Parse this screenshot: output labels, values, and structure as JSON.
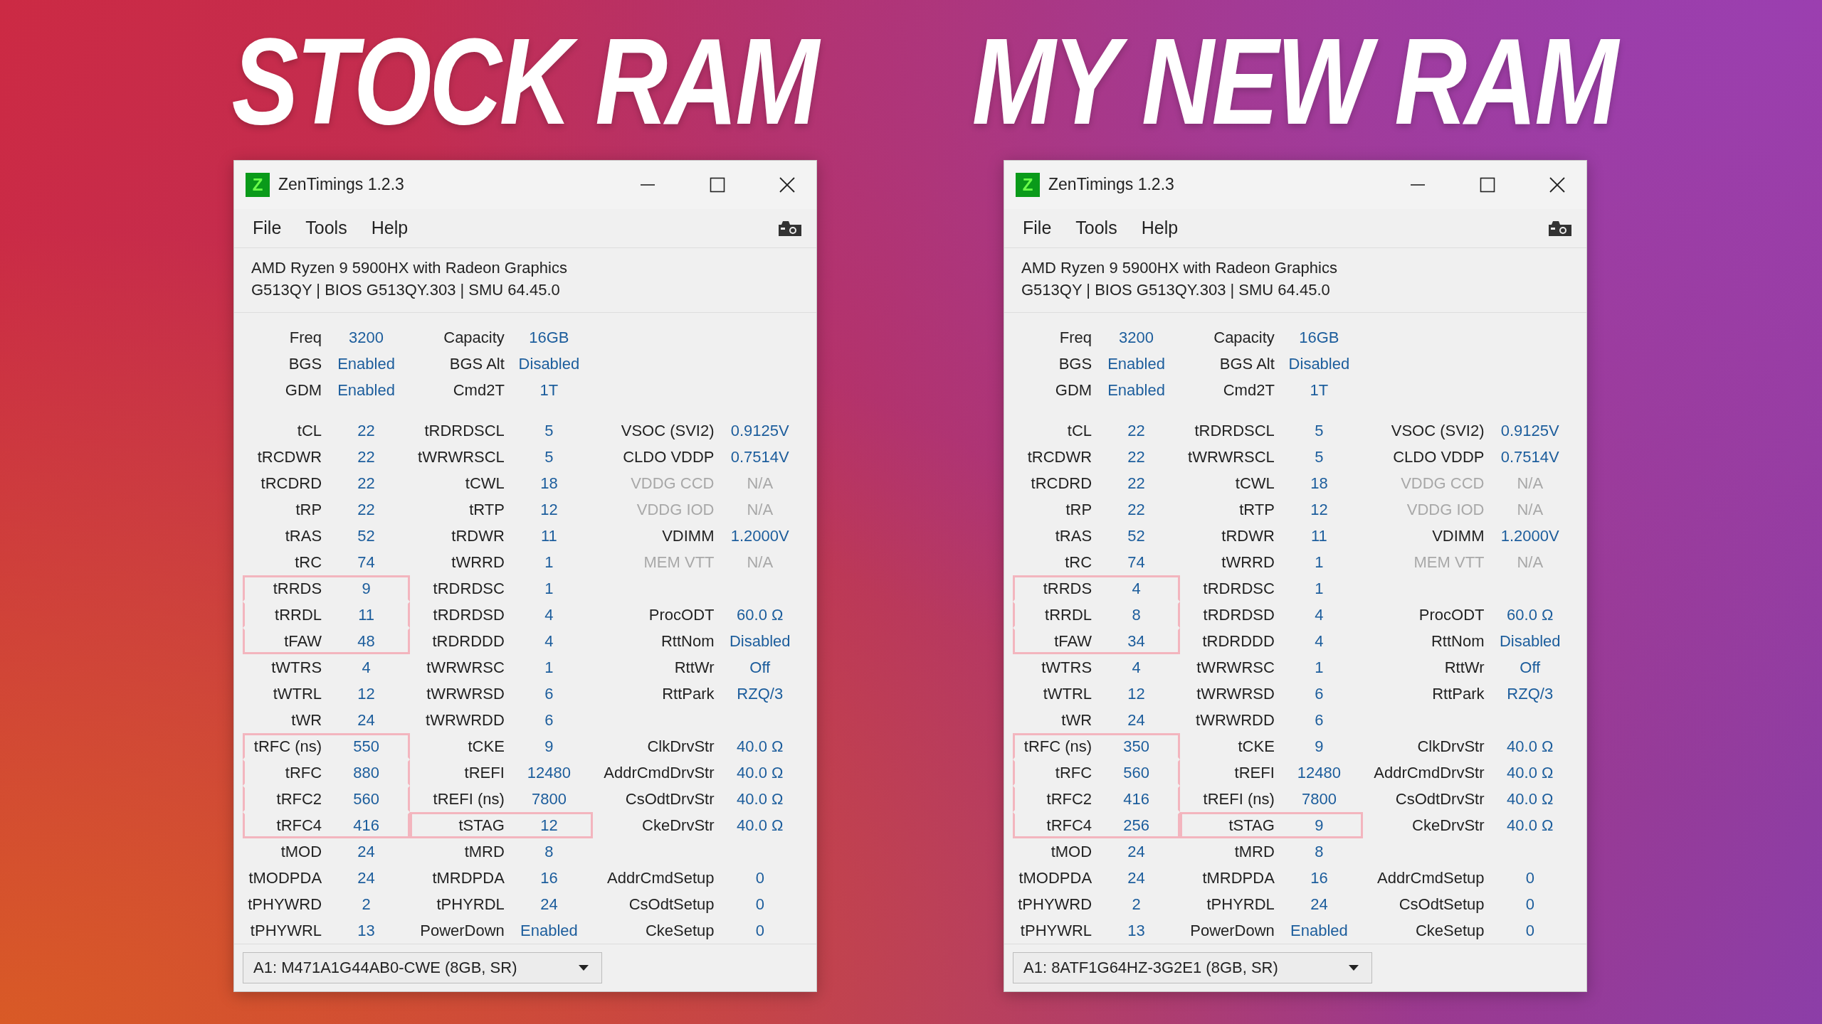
{
  "headlines": [
    "STOCK RAM",
    "MY NEW RAM"
  ],
  "windows": [
    {
      "title": "ZenTimings 1.2.3",
      "icon_letter": "Z",
      "menu": [
        "File",
        "Tools",
        "Help"
      ],
      "cpu": "AMD Ryzen 9 5900HX with Radeon Graphics",
      "bios": "G513QY | BIOS G513QY.303 | SMU 64.45.0",
      "summary": [
        [
          {
            "label": "Freq",
            "value": "3200"
          },
          {
            "label": "Capacity",
            "value": "16GB"
          }
        ],
        [
          {
            "label": "BGS",
            "value": "Enabled"
          },
          {
            "label": "BGS Alt",
            "value": "Disabled"
          }
        ],
        [
          {
            "label": "GDM",
            "value": "Enabled"
          },
          {
            "label": "Cmd2T",
            "value": "1T"
          }
        ]
      ],
      "rows": [
        [
          {
            "label": "tCL",
            "value": "22",
            "highlighted": false,
            "disabled": false
          },
          {
            "label": "tRDRDSCL",
            "value": "5",
            "highlighted": false,
            "disabled": false
          },
          {
            "label": "VSOC (SVI2)",
            "value": "0.9125V",
            "highlighted": false,
            "disabled": false
          }
        ],
        [
          {
            "label": "tRCDWR",
            "value": "22",
            "highlighted": false,
            "disabled": false
          },
          {
            "label": "tWRWRSCL",
            "value": "5",
            "highlighted": false,
            "disabled": false
          },
          {
            "label": "CLDO VDDP",
            "value": "0.7514V",
            "highlighted": false,
            "disabled": false
          }
        ],
        [
          {
            "label": "tRCDRD",
            "value": "22",
            "highlighted": false,
            "disabled": false
          },
          {
            "label": "tCWL",
            "value": "18",
            "highlighted": false,
            "disabled": false
          },
          {
            "label": "VDDG CCD",
            "value": "N/A",
            "highlighted": false,
            "disabled": true
          }
        ],
        [
          {
            "label": "tRP",
            "value": "22",
            "highlighted": false,
            "disabled": false
          },
          {
            "label": "tRTP",
            "value": "12",
            "highlighted": false,
            "disabled": false
          },
          {
            "label": "VDDG IOD",
            "value": "N/A",
            "highlighted": false,
            "disabled": true
          }
        ],
        [
          {
            "label": "tRAS",
            "value": "52",
            "highlighted": false,
            "disabled": false
          },
          {
            "label": "tRDWR",
            "value": "11",
            "highlighted": false,
            "disabled": false
          },
          {
            "label": "VDIMM",
            "value": "1.2000V",
            "highlighted": false,
            "disabled": false
          }
        ],
        [
          {
            "label": "tRC",
            "value": "74",
            "highlighted": false,
            "disabled": false
          },
          {
            "label": "tWRRD",
            "value": "1",
            "highlighted": false,
            "disabled": false
          },
          {
            "label": "MEM VTT",
            "value": "N/A",
            "highlighted": false,
            "disabled": true
          }
        ],
        [
          {
            "label": "tRRDS",
            "value": "9",
            "highlighted": true,
            "disabled": false
          },
          {
            "label": "tRDRDSC",
            "value": "1",
            "highlighted": false,
            "disabled": false
          }
        ],
        [
          {
            "label": "tRRDL",
            "value": "11",
            "highlighted": true,
            "disabled": false
          },
          {
            "label": "tRDRDSD",
            "value": "4",
            "highlighted": false,
            "disabled": false
          },
          {
            "label": "ProcODT",
            "value": "60.0 Ω",
            "highlighted": false,
            "disabled": false
          }
        ],
        [
          {
            "label": "tFAW",
            "value": "48",
            "highlighted": true,
            "disabled": false
          },
          {
            "label": "tRDRDDD",
            "value": "4",
            "highlighted": false,
            "disabled": false
          },
          {
            "label": "RttNom",
            "value": "Disabled",
            "highlighted": false,
            "disabled": false
          }
        ],
        [
          {
            "label": "tWTRS",
            "value": "4",
            "highlighted": false,
            "disabled": false
          },
          {
            "label": "tWRWRSC",
            "value": "1",
            "highlighted": false,
            "disabled": false
          },
          {
            "label": "RttWr",
            "value": "Off",
            "highlighted": false,
            "disabled": false
          }
        ],
        [
          {
            "label": "tWTRL",
            "value": "12",
            "highlighted": false,
            "disabled": false
          },
          {
            "label": "tWRWRSD",
            "value": "6",
            "highlighted": false,
            "disabled": false
          },
          {
            "label": "RttPark",
            "value": "RZQ/3",
            "highlighted": false,
            "disabled": false
          }
        ],
        [
          {
            "label": "tWR",
            "value": "24",
            "highlighted": false,
            "disabled": false
          },
          {
            "label": "tWRWRDD",
            "value": "6",
            "highlighted": false,
            "disabled": false
          }
        ],
        [
          {
            "label": "tRFC (ns)",
            "value": "550",
            "highlighted": true,
            "disabled": false
          },
          {
            "label": "tCKE",
            "value": "9",
            "highlighted": false,
            "disabled": false
          },
          {
            "label": "ClkDrvStr",
            "value": "40.0 Ω",
            "highlighted": false,
            "disabled": false
          }
        ],
        [
          {
            "label": "tRFC",
            "value": "880",
            "highlighted": true,
            "disabled": false
          },
          {
            "label": "tREFI",
            "value": "12480",
            "highlighted": false,
            "disabled": false
          },
          {
            "label": "AddrCmdDrvStr",
            "value": "40.0 Ω",
            "highlighted": false,
            "disabled": false
          }
        ],
        [
          {
            "label": "tRFC2",
            "value": "560",
            "highlighted": true,
            "disabled": false
          },
          {
            "label": "tREFI (ns)",
            "value": "7800",
            "highlighted": false,
            "disabled": false
          },
          {
            "label": "CsOdtDrvStr",
            "value": "40.0 Ω",
            "highlighted": false,
            "disabled": false
          }
        ],
        [
          {
            "label": "tRFC4",
            "value": "416",
            "highlighted": true,
            "disabled": false
          },
          {
            "label": "tSTAG",
            "value": "12",
            "highlighted": true,
            "disabled": false
          },
          {
            "label": "CkeDrvStr",
            "value": "40.0 Ω",
            "highlighted": false,
            "disabled": false
          }
        ],
        [
          {
            "label": "tMOD",
            "value": "24",
            "highlighted": false,
            "disabled": false
          },
          {
            "label": "tMRD",
            "value": "8",
            "highlighted": false,
            "disabled": false
          }
        ],
        [
          {
            "label": "tMODPDA",
            "value": "24",
            "highlighted": false,
            "disabled": false
          },
          {
            "label": "tMRDPDA",
            "value": "16",
            "highlighted": false,
            "disabled": false
          },
          {
            "label": "AddrCmdSetup",
            "value": "0",
            "highlighted": false,
            "disabled": false
          }
        ],
        [
          {
            "label": "tPHYWRD",
            "value": "2",
            "highlighted": false,
            "disabled": false
          },
          {
            "label": "tPHYRDL",
            "value": "24",
            "highlighted": false,
            "disabled": false
          },
          {
            "label": "CsOdtSetup",
            "value": "0",
            "highlighted": false,
            "disabled": false
          }
        ],
        [
          {
            "label": "tPHYWRL",
            "value": "13",
            "highlighted": false,
            "disabled": false
          },
          {
            "label": "PowerDown",
            "value": "Enabled",
            "highlighted": false,
            "disabled": false
          },
          {
            "label": "CkeSetup",
            "value": "0",
            "highlighted": false,
            "disabled": false
          }
        ]
      ],
      "dimm": "A1: M471A1G44AB0-CWE (8GB, SR)"
    },
    {
      "title": "ZenTimings 1.2.3",
      "icon_letter": "Z",
      "menu": [
        "File",
        "Tools",
        "Help"
      ],
      "cpu": "AMD Ryzen 9 5900HX with Radeon Graphics",
      "bios": "G513QY | BIOS G513QY.303 | SMU 64.45.0",
      "summary": [
        [
          {
            "label": "Freq",
            "value": "3200"
          },
          {
            "label": "Capacity",
            "value": "16GB"
          }
        ],
        [
          {
            "label": "BGS",
            "value": "Enabled"
          },
          {
            "label": "BGS Alt",
            "value": "Disabled"
          }
        ],
        [
          {
            "label": "GDM",
            "value": "Enabled"
          },
          {
            "label": "Cmd2T",
            "value": "1T"
          }
        ]
      ],
      "rows": [
        [
          {
            "label": "tCL",
            "value": "22",
            "highlighted": false,
            "disabled": false
          },
          {
            "label": "tRDRDSCL",
            "value": "5",
            "highlighted": false,
            "disabled": false
          },
          {
            "label": "VSOC (SVI2)",
            "value": "0.9125V",
            "highlighted": false,
            "disabled": false
          }
        ],
        [
          {
            "label": "tRCDWR",
            "value": "22",
            "highlighted": false,
            "disabled": false
          },
          {
            "label": "tWRWRSCL",
            "value": "5",
            "highlighted": false,
            "disabled": false
          },
          {
            "label": "CLDO VDDP",
            "value": "0.7514V",
            "highlighted": false,
            "disabled": false
          }
        ],
        [
          {
            "label": "tRCDRD",
            "value": "22",
            "highlighted": false,
            "disabled": false
          },
          {
            "label": "tCWL",
            "value": "18",
            "highlighted": false,
            "disabled": false
          },
          {
            "label": "VDDG CCD",
            "value": "N/A",
            "highlighted": false,
            "disabled": true
          }
        ],
        [
          {
            "label": "tRP",
            "value": "22",
            "highlighted": false,
            "disabled": false
          },
          {
            "label": "tRTP",
            "value": "12",
            "highlighted": false,
            "disabled": false
          },
          {
            "label": "VDDG IOD",
            "value": "N/A",
            "highlighted": false,
            "disabled": true
          }
        ],
        [
          {
            "label": "tRAS",
            "value": "52",
            "highlighted": false,
            "disabled": false
          },
          {
            "label": "tRDWR",
            "value": "11",
            "highlighted": false,
            "disabled": false
          },
          {
            "label": "VDIMM",
            "value": "1.2000V",
            "highlighted": false,
            "disabled": false
          }
        ],
        [
          {
            "label": "tRC",
            "value": "74",
            "highlighted": false,
            "disabled": false
          },
          {
            "label": "tWRRD",
            "value": "1",
            "highlighted": false,
            "disabled": false
          },
          {
            "label": "MEM VTT",
            "value": "N/A",
            "highlighted": false,
            "disabled": true
          }
        ],
        [
          {
            "label": "tRRDS",
            "value": "4",
            "highlighted": true,
            "disabled": false
          },
          {
            "label": "tRDRDSC",
            "value": "1",
            "highlighted": false,
            "disabled": false
          }
        ],
        [
          {
            "label": "tRRDL",
            "value": "8",
            "highlighted": true,
            "disabled": false
          },
          {
            "label": "tRDRDSD",
            "value": "4",
            "highlighted": false,
            "disabled": false
          },
          {
            "label": "ProcODT",
            "value": "60.0 Ω",
            "highlighted": false,
            "disabled": false
          }
        ],
        [
          {
            "label": "tFAW",
            "value": "34",
            "highlighted": true,
            "disabled": false
          },
          {
            "label": "tRDRDDD",
            "value": "4",
            "highlighted": false,
            "disabled": false
          },
          {
            "label": "RttNom",
            "value": "Disabled",
            "highlighted": false,
            "disabled": false
          }
        ],
        [
          {
            "label": "tWTRS",
            "value": "4",
            "highlighted": false,
            "disabled": false
          },
          {
            "label": "tWRWRSC",
            "value": "1",
            "highlighted": false,
            "disabled": false
          },
          {
            "label": "RttWr",
            "value": "Off",
            "highlighted": false,
            "disabled": false
          }
        ],
        [
          {
            "label": "tWTRL",
            "value": "12",
            "highlighted": false,
            "disabled": false
          },
          {
            "label": "tWRWRSD",
            "value": "6",
            "highlighted": false,
            "disabled": false
          },
          {
            "label": "RttPark",
            "value": "RZQ/3",
            "highlighted": false,
            "disabled": false
          }
        ],
        [
          {
            "label": "tWR",
            "value": "24",
            "highlighted": false,
            "disabled": false
          },
          {
            "label": "tWRWRDD",
            "value": "6",
            "highlighted": false,
            "disabled": false
          }
        ],
        [
          {
            "label": "tRFC (ns)",
            "value": "350",
            "highlighted": true,
            "disabled": false
          },
          {
            "label": "tCKE",
            "value": "9",
            "highlighted": false,
            "disabled": false
          },
          {
            "label": "ClkDrvStr",
            "value": "40.0 Ω",
            "highlighted": false,
            "disabled": false
          }
        ],
        [
          {
            "label": "tRFC",
            "value": "560",
            "highlighted": true,
            "disabled": false
          },
          {
            "label": "tREFI",
            "value": "12480",
            "highlighted": false,
            "disabled": false
          },
          {
            "label": "AddrCmdDrvStr",
            "value": "40.0 Ω",
            "highlighted": false,
            "disabled": false
          }
        ],
        [
          {
            "label": "tRFC2",
            "value": "416",
            "highlighted": true,
            "disabled": false
          },
          {
            "label": "tREFI (ns)",
            "value": "7800",
            "highlighted": false,
            "disabled": false
          },
          {
            "label": "CsOdtDrvStr",
            "value": "40.0 Ω",
            "highlighted": false,
            "disabled": false
          }
        ],
        [
          {
            "label": "tRFC4",
            "value": "256",
            "highlighted": true,
            "disabled": false
          },
          {
            "label": "tSTAG",
            "value": "9",
            "highlighted": true,
            "disabled": false
          },
          {
            "label": "CkeDrvStr",
            "value": "40.0 Ω",
            "highlighted": false,
            "disabled": false
          }
        ],
        [
          {
            "label": "tMOD",
            "value": "24",
            "highlighted": false,
            "disabled": false
          },
          {
            "label": "tMRD",
            "value": "8",
            "highlighted": false,
            "disabled": false
          }
        ],
        [
          {
            "label": "tMODPDA",
            "value": "24",
            "highlighted": false,
            "disabled": false
          },
          {
            "label": "tMRDPDA",
            "value": "16",
            "highlighted": false,
            "disabled": false
          },
          {
            "label": "AddrCmdSetup",
            "value": "0",
            "highlighted": false,
            "disabled": false
          }
        ],
        [
          {
            "label": "tPHYWRD",
            "value": "2",
            "highlighted": false,
            "disabled": false
          },
          {
            "label": "tPHYRDL",
            "value": "24",
            "highlighted": false,
            "disabled": false
          },
          {
            "label": "CsOdtSetup",
            "value": "0",
            "highlighted": false,
            "disabled": false
          }
        ],
        [
          {
            "label": "tPHYWRL",
            "value": "13",
            "highlighted": false,
            "disabled": false
          },
          {
            "label": "PowerDown",
            "value": "Enabled",
            "highlighted": false,
            "disabled": false
          },
          {
            "label": "CkeSetup",
            "value": "0",
            "highlighted": false,
            "disabled": false
          }
        ]
      ],
      "dimm": "A1: 8ATF1G64HZ-3G2E1 (8GB, SR)"
    }
  ]
}
